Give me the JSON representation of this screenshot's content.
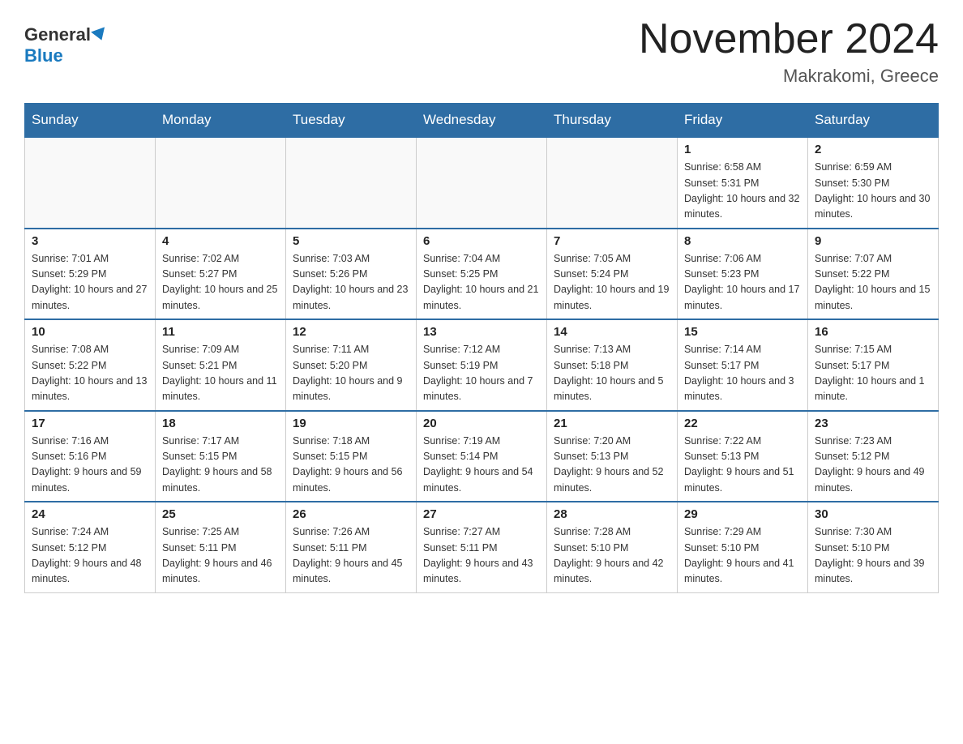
{
  "header": {
    "logo_general": "General",
    "logo_blue": "Blue",
    "title": "November 2024",
    "subtitle": "Makrakomi, Greece"
  },
  "weekdays": [
    "Sunday",
    "Monday",
    "Tuesday",
    "Wednesday",
    "Thursday",
    "Friday",
    "Saturday"
  ],
  "weeks": [
    [
      {
        "day": "",
        "sunrise": "",
        "sunset": "",
        "daylight": ""
      },
      {
        "day": "",
        "sunrise": "",
        "sunset": "",
        "daylight": ""
      },
      {
        "day": "",
        "sunrise": "",
        "sunset": "",
        "daylight": ""
      },
      {
        "day": "",
        "sunrise": "",
        "sunset": "",
        "daylight": ""
      },
      {
        "day": "",
        "sunrise": "",
        "sunset": "",
        "daylight": ""
      },
      {
        "day": "1",
        "sunrise": "Sunrise: 6:58 AM",
        "sunset": "Sunset: 5:31 PM",
        "daylight": "Daylight: 10 hours and 32 minutes."
      },
      {
        "day": "2",
        "sunrise": "Sunrise: 6:59 AM",
        "sunset": "Sunset: 5:30 PM",
        "daylight": "Daylight: 10 hours and 30 minutes."
      }
    ],
    [
      {
        "day": "3",
        "sunrise": "Sunrise: 7:01 AM",
        "sunset": "Sunset: 5:29 PM",
        "daylight": "Daylight: 10 hours and 27 minutes."
      },
      {
        "day": "4",
        "sunrise": "Sunrise: 7:02 AM",
        "sunset": "Sunset: 5:27 PM",
        "daylight": "Daylight: 10 hours and 25 minutes."
      },
      {
        "day": "5",
        "sunrise": "Sunrise: 7:03 AM",
        "sunset": "Sunset: 5:26 PM",
        "daylight": "Daylight: 10 hours and 23 minutes."
      },
      {
        "day": "6",
        "sunrise": "Sunrise: 7:04 AM",
        "sunset": "Sunset: 5:25 PM",
        "daylight": "Daylight: 10 hours and 21 minutes."
      },
      {
        "day": "7",
        "sunrise": "Sunrise: 7:05 AM",
        "sunset": "Sunset: 5:24 PM",
        "daylight": "Daylight: 10 hours and 19 minutes."
      },
      {
        "day": "8",
        "sunrise": "Sunrise: 7:06 AM",
        "sunset": "Sunset: 5:23 PM",
        "daylight": "Daylight: 10 hours and 17 minutes."
      },
      {
        "day": "9",
        "sunrise": "Sunrise: 7:07 AM",
        "sunset": "Sunset: 5:22 PM",
        "daylight": "Daylight: 10 hours and 15 minutes."
      }
    ],
    [
      {
        "day": "10",
        "sunrise": "Sunrise: 7:08 AM",
        "sunset": "Sunset: 5:22 PM",
        "daylight": "Daylight: 10 hours and 13 minutes."
      },
      {
        "day": "11",
        "sunrise": "Sunrise: 7:09 AM",
        "sunset": "Sunset: 5:21 PM",
        "daylight": "Daylight: 10 hours and 11 minutes."
      },
      {
        "day": "12",
        "sunrise": "Sunrise: 7:11 AM",
        "sunset": "Sunset: 5:20 PM",
        "daylight": "Daylight: 10 hours and 9 minutes."
      },
      {
        "day": "13",
        "sunrise": "Sunrise: 7:12 AM",
        "sunset": "Sunset: 5:19 PM",
        "daylight": "Daylight: 10 hours and 7 minutes."
      },
      {
        "day": "14",
        "sunrise": "Sunrise: 7:13 AM",
        "sunset": "Sunset: 5:18 PM",
        "daylight": "Daylight: 10 hours and 5 minutes."
      },
      {
        "day": "15",
        "sunrise": "Sunrise: 7:14 AM",
        "sunset": "Sunset: 5:17 PM",
        "daylight": "Daylight: 10 hours and 3 minutes."
      },
      {
        "day": "16",
        "sunrise": "Sunrise: 7:15 AM",
        "sunset": "Sunset: 5:17 PM",
        "daylight": "Daylight: 10 hours and 1 minute."
      }
    ],
    [
      {
        "day": "17",
        "sunrise": "Sunrise: 7:16 AM",
        "sunset": "Sunset: 5:16 PM",
        "daylight": "Daylight: 9 hours and 59 minutes."
      },
      {
        "day": "18",
        "sunrise": "Sunrise: 7:17 AM",
        "sunset": "Sunset: 5:15 PM",
        "daylight": "Daylight: 9 hours and 58 minutes."
      },
      {
        "day": "19",
        "sunrise": "Sunrise: 7:18 AM",
        "sunset": "Sunset: 5:15 PM",
        "daylight": "Daylight: 9 hours and 56 minutes."
      },
      {
        "day": "20",
        "sunrise": "Sunrise: 7:19 AM",
        "sunset": "Sunset: 5:14 PM",
        "daylight": "Daylight: 9 hours and 54 minutes."
      },
      {
        "day": "21",
        "sunrise": "Sunrise: 7:20 AM",
        "sunset": "Sunset: 5:13 PM",
        "daylight": "Daylight: 9 hours and 52 minutes."
      },
      {
        "day": "22",
        "sunrise": "Sunrise: 7:22 AM",
        "sunset": "Sunset: 5:13 PM",
        "daylight": "Daylight: 9 hours and 51 minutes."
      },
      {
        "day": "23",
        "sunrise": "Sunrise: 7:23 AM",
        "sunset": "Sunset: 5:12 PM",
        "daylight": "Daylight: 9 hours and 49 minutes."
      }
    ],
    [
      {
        "day": "24",
        "sunrise": "Sunrise: 7:24 AM",
        "sunset": "Sunset: 5:12 PM",
        "daylight": "Daylight: 9 hours and 48 minutes."
      },
      {
        "day": "25",
        "sunrise": "Sunrise: 7:25 AM",
        "sunset": "Sunset: 5:11 PM",
        "daylight": "Daylight: 9 hours and 46 minutes."
      },
      {
        "day": "26",
        "sunrise": "Sunrise: 7:26 AM",
        "sunset": "Sunset: 5:11 PM",
        "daylight": "Daylight: 9 hours and 45 minutes."
      },
      {
        "day": "27",
        "sunrise": "Sunrise: 7:27 AM",
        "sunset": "Sunset: 5:11 PM",
        "daylight": "Daylight: 9 hours and 43 minutes."
      },
      {
        "day": "28",
        "sunrise": "Sunrise: 7:28 AM",
        "sunset": "Sunset: 5:10 PM",
        "daylight": "Daylight: 9 hours and 42 minutes."
      },
      {
        "day": "29",
        "sunrise": "Sunrise: 7:29 AM",
        "sunset": "Sunset: 5:10 PM",
        "daylight": "Daylight: 9 hours and 41 minutes."
      },
      {
        "day": "30",
        "sunrise": "Sunrise: 7:30 AM",
        "sunset": "Sunset: 5:10 PM",
        "daylight": "Daylight: 9 hours and 39 minutes."
      }
    ]
  ]
}
